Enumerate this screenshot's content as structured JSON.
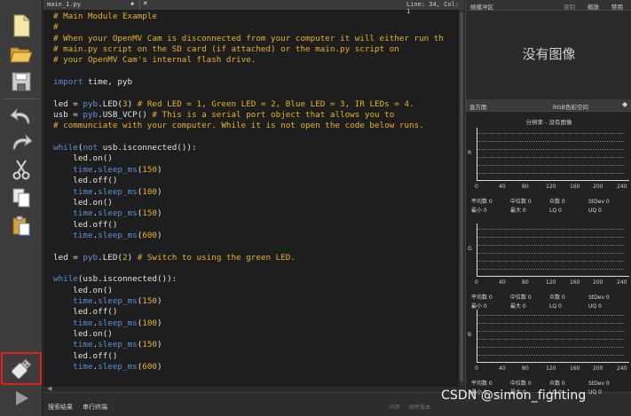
{
  "editor": {
    "file_name": "main_1.py",
    "file_chevron": "◆",
    "close_glyph": "✕",
    "line_col": "Line: 34, Col: 1",
    "code_lines": [
      [
        [
          "c-comment",
          "# Main Module Example"
        ]
      ],
      [
        [
          "c-comment",
          "#"
        ]
      ],
      [
        [
          "c-comment",
          "# When your OpenMV Cam is disconnected from your computer it will either run th"
        ]
      ],
      [
        [
          "c-comment",
          "# main.py script on the SD card (if attached) or the main.py script on"
        ]
      ],
      [
        [
          "c-comment",
          "# your OpenMV Cam's internal flash drive."
        ]
      ],
      [
        [
          "",
          ""
        ]
      ],
      [
        [
          "c-kw",
          "import"
        ],
        [
          "",
          " time, pyb"
        ]
      ],
      [
        [
          "",
          ""
        ]
      ],
      [
        [
          "",
          "led = "
        ],
        [
          "c-fn",
          "pyb"
        ],
        [
          "",
          ".LED("
        ],
        [
          "c-num",
          "3"
        ],
        [
          "",
          ") "
        ],
        [
          "c-comment",
          "# Red LED = 1, Green LED = 2, Blue LED = 3, IR LEDs = 4."
        ]
      ],
      [
        [
          "",
          "usb = "
        ],
        [
          "c-fn",
          "pyb"
        ],
        [
          "",
          ".USB_VCP() "
        ],
        [
          "c-comment",
          "# This is a serial port object that allows you to"
        ]
      ],
      [
        [
          "c-comment",
          "# communciate with your computer. While it is not open the code below runs."
        ]
      ],
      [
        [
          "",
          ""
        ]
      ],
      [
        [
          "c-kw",
          "while"
        ],
        [
          "",
          "("
        ],
        [
          "c-kw",
          "not"
        ],
        [
          "",
          " usb.isconnected()):"
        ]
      ],
      [
        [
          "",
          "    led.on()"
        ]
      ],
      [
        [
          "",
          "    "
        ],
        [
          "c-fn",
          "time"
        ],
        [
          "",
          "."
        ],
        [
          "c-fn",
          "sleep_ms"
        ],
        [
          "",
          "("
        ],
        [
          "c-num",
          "150"
        ],
        [
          "",
          ")"
        ]
      ],
      [
        [
          "",
          "    led.off()"
        ]
      ],
      [
        [
          "",
          "    "
        ],
        [
          "c-fn",
          "time"
        ],
        [
          "",
          "."
        ],
        [
          "c-fn",
          "sleep_ms"
        ],
        [
          "",
          "("
        ],
        [
          "c-num",
          "100"
        ],
        [
          "",
          ")"
        ]
      ],
      [
        [
          "",
          "    led.on()"
        ]
      ],
      [
        [
          "",
          "    "
        ],
        [
          "c-fn",
          "time"
        ],
        [
          "",
          "."
        ],
        [
          "c-fn",
          "sleep_ms"
        ],
        [
          "",
          "("
        ],
        [
          "c-num",
          "150"
        ],
        [
          "",
          ")"
        ]
      ],
      [
        [
          "",
          "    led.off()"
        ]
      ],
      [
        [
          "",
          "    "
        ],
        [
          "c-fn",
          "time"
        ],
        [
          "",
          "."
        ],
        [
          "c-fn",
          "sleep_ms"
        ],
        [
          "",
          "("
        ],
        [
          "c-num",
          "600"
        ],
        [
          "",
          ")"
        ]
      ],
      [
        [
          "",
          ""
        ]
      ],
      [
        [
          "",
          "led = "
        ],
        [
          "c-fn",
          "pyb"
        ],
        [
          "",
          ".LED("
        ],
        [
          "c-num",
          "2"
        ],
        [
          "",
          ") "
        ],
        [
          "c-comment",
          "# Switch to using the green LED."
        ]
      ],
      [
        [
          "",
          ""
        ]
      ],
      [
        [
          "c-kw",
          "while"
        ],
        [
          "",
          "(usb.isconnected()):"
        ]
      ],
      [
        [
          "",
          "    led.on()"
        ]
      ],
      [
        [
          "",
          "    "
        ],
        [
          "c-fn",
          "time"
        ],
        [
          "",
          "."
        ],
        [
          "c-fn",
          "sleep_ms"
        ],
        [
          "",
          "("
        ],
        [
          "c-num",
          "150"
        ],
        [
          "",
          ")"
        ]
      ],
      [
        [
          "",
          "    led.off()"
        ]
      ],
      [
        [
          "",
          "    "
        ],
        [
          "c-fn",
          "time"
        ],
        [
          "",
          "."
        ],
        [
          "c-fn",
          "sleep_ms"
        ],
        [
          "",
          "("
        ],
        [
          "c-num",
          "100"
        ],
        [
          "",
          ")"
        ]
      ],
      [
        [
          "",
          "    led.on()"
        ]
      ],
      [
        [
          "",
          "    "
        ],
        [
          "c-fn",
          "time"
        ],
        [
          "",
          "."
        ],
        [
          "c-fn",
          "sleep_ms"
        ],
        [
          "",
          "("
        ],
        [
          "c-num",
          "150"
        ],
        [
          "",
          ")"
        ]
      ],
      [
        [
          "",
          "    led.off()"
        ]
      ],
      [
        [
          "",
          "    "
        ],
        [
          "c-fn",
          "time"
        ],
        [
          "",
          "."
        ],
        [
          "c-fn",
          "sleep_ms"
        ],
        [
          "",
          "("
        ],
        [
          "c-num",
          "600"
        ],
        [
          "",
          ")"
        ]
      ]
    ]
  },
  "toolbar": {
    "icons": [
      "new-file-icon",
      "open-folder-icon",
      "save-icon",
      "undo-icon",
      "redo-icon",
      "cut-icon",
      "copy-icon",
      "paste-icon",
      "connect-usb-icon",
      "run-icon"
    ]
  },
  "frame_buffer": {
    "title": "帧缓冲区",
    "record": "录制",
    "zoom": "缩放",
    "disable": "禁用",
    "no_image": "没有图像"
  },
  "histogram": {
    "title": "直方图",
    "colorspace": "RGB色彩空间",
    "dropdown_glyph": "◆",
    "resolution": "分辨率 - 没有图像",
    "channels": [
      "R",
      "G",
      "B"
    ],
    "x_ticks": [
      "0",
      "40",
      "80",
      "120",
      "160",
      "200",
      "240"
    ],
    "stat_row1": [
      "平均数 0",
      "中位数 0",
      "众数 0",
      "StDev 0"
    ],
    "stat_row2": [
      "最小 0",
      "最大 0",
      "LQ 0",
      "UQ 0"
    ]
  },
  "bottom": {
    "search_tab": "搜索结果",
    "serial_tab": "串行终端",
    "misc1": "内存",
    "misc2": "固件版本"
  },
  "watermark": "CSDN @simon_fighting",
  "colors": {
    "comment": "#e6b325",
    "keyword": "#5b8fd6",
    "highlight_border": "#e0201c"
  }
}
